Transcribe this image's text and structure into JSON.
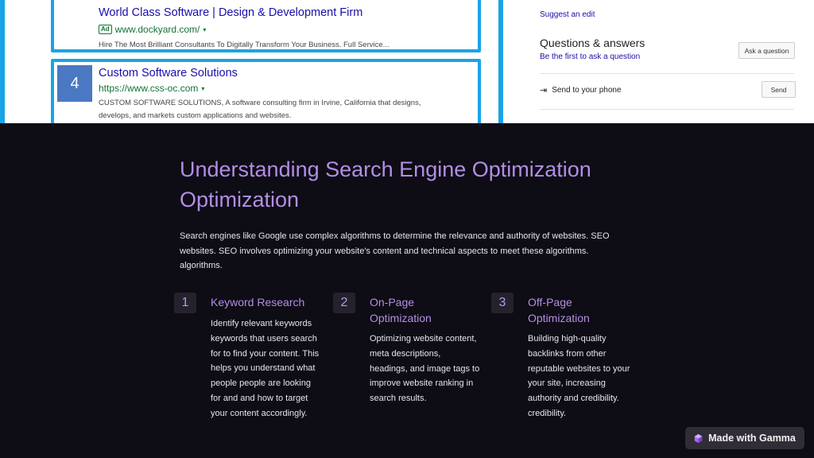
{
  "screenshot": {
    "ad1": {
      "title": "World Class Software | Design & Development Firm",
      "badge": "Ad",
      "url": "www.dockyard.com/",
      "desc": "Hire The Most Brilliant Consultants To Digitally Transform Your Business. Full Service..."
    },
    "ad2": {
      "number": "4",
      "title": "Custom Software Solutions",
      "url": "https://www.css-oc.com",
      "desc_line1": "CUSTOM SOFTWARE SOLUTIONS, A software consulting firm in Irvine, California that designs,",
      "desc_line2": "develops, and markets custom applications and websites."
    },
    "panel": {
      "suggest": "Suggest an edit",
      "qa_title": "Questions & answers",
      "qa_sub": "Be the first to ask a question",
      "ask_button": "Ask a question",
      "send_label": "Send to your phone",
      "send_button": "Send"
    }
  },
  "slide": {
    "title": "Understanding Search Engine Optimization Optimization",
    "intro": "Search engines like Google use complex algorithms to determine the relevance and authority of websites. SEO websites. SEO involves optimizing your website's content and technical aspects to meet these algorithms. algorithms.",
    "steps": [
      {
        "number": "1",
        "title": "Keyword Research",
        "body": "Identify relevant keywords keywords that users search for to find your content. This helps you understand what people people are looking for and and how to target your content accordingly."
      },
      {
        "number": "2",
        "title": "On-Page Optimization",
        "body": "Optimizing website content, meta descriptions, headings, and image tags to improve website ranking in search results."
      },
      {
        "number": "3",
        "title": "Off-Page Optimization",
        "body": "Building high-quality backlinks from other reputable websites to your your site, increasing authority and credibility. credibility."
      }
    ]
  },
  "badge": {
    "label": "Made with Gamma",
    "icon": "gamma-logo-icon"
  },
  "colors": {
    "accent": "#b28ee6",
    "background": "#0e0c14",
    "link": "#1a0dab",
    "frame": "#19a4e5"
  }
}
